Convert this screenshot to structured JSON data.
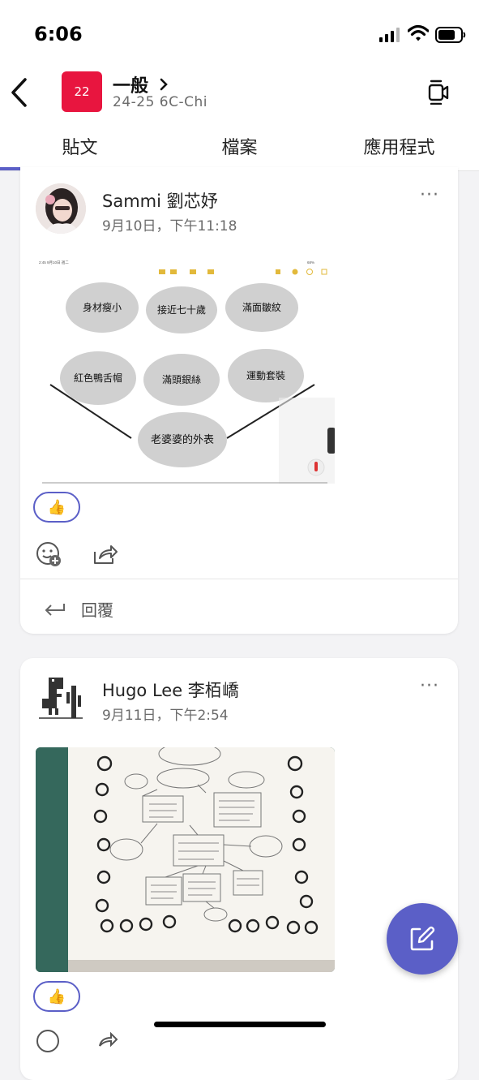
{
  "status": {
    "time": "6:06"
  },
  "header": {
    "team_avatar": "22",
    "channel_title": "一般",
    "channel_sub": "24-25 6C-Chi"
  },
  "tabs": [
    {
      "label": "貼文",
      "active": true
    },
    {
      "label": "檔案",
      "active": false
    },
    {
      "label": "應用程式",
      "active": false
    }
  ],
  "posts": [
    {
      "author": "Sammi 劉芯妤",
      "date": "9月10日，下午11:18",
      "image": {
        "type": "mind-map-screenshot",
        "topbar_text": "2:45  9月10日 週二",
        "topbar_status": "68%",
        "center": "老婆婆的外表",
        "nodes": [
          "身材瘦小",
          "接近七十歲",
          "滿面皺紋",
          "紅色鴨舌帽",
          "滿頭銀絲",
          "運動套裝"
        ]
      },
      "reaction": "👍",
      "reply_label": "回覆"
    },
    {
      "author": "Hugo Lee 李栢嶠",
      "date": "9月11日，下午2:54",
      "image": {
        "type": "handwritten-mind-map-photo"
      },
      "reaction": "👍"
    }
  ],
  "colors": {
    "accent": "#5b5fc7",
    "team_avatar": "#e8153f"
  }
}
